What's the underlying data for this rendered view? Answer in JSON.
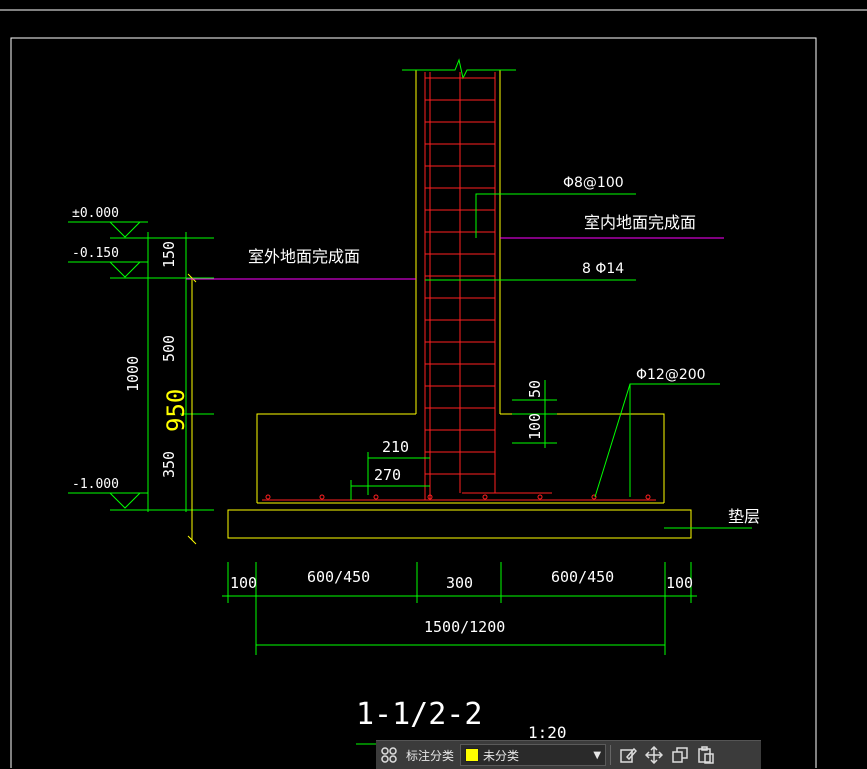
{
  "drawing": {
    "elevations": {
      "top": "±0.000",
      "outdoor": "-0.150",
      "bottom": "-1.000"
    },
    "labels": {
      "outdoor_floor": "室外地面完成面",
      "indoor_floor": "室内地面完成面",
      "stirrup": "Φ8@100",
      "vertical_bars": "8 Φ14",
      "bottom_bars": "Φ12@200",
      "cushion": "垫层"
    },
    "dims": {
      "d150": "150",
      "d500": "500",
      "d1000": "1000",
      "d350": "350",
      "d950": "950",
      "d50": "50",
      "d100v": "100",
      "d210": "210",
      "d270": "270",
      "d100a": "100",
      "d600a": "600/450",
      "d300": "300",
      "d600b": "600/450",
      "d100b": "100",
      "d1500": "1500/1200"
    },
    "title": "1-1/2-2",
    "scale": "1:20"
  },
  "toolbar": {
    "label": "标注分类",
    "dropdown_value": "未分类",
    "dropdown_color": "#ffff00",
    "icons": [
      "grid-icon",
      "edit-icon",
      "move-icon",
      "copy-icon",
      "paste-icon"
    ]
  },
  "colors": {
    "green": "#00ff00",
    "yellow": "#ffff00",
    "red": "#ff2020",
    "magenta": "#ff00ff",
    "white": "#ffffff"
  }
}
